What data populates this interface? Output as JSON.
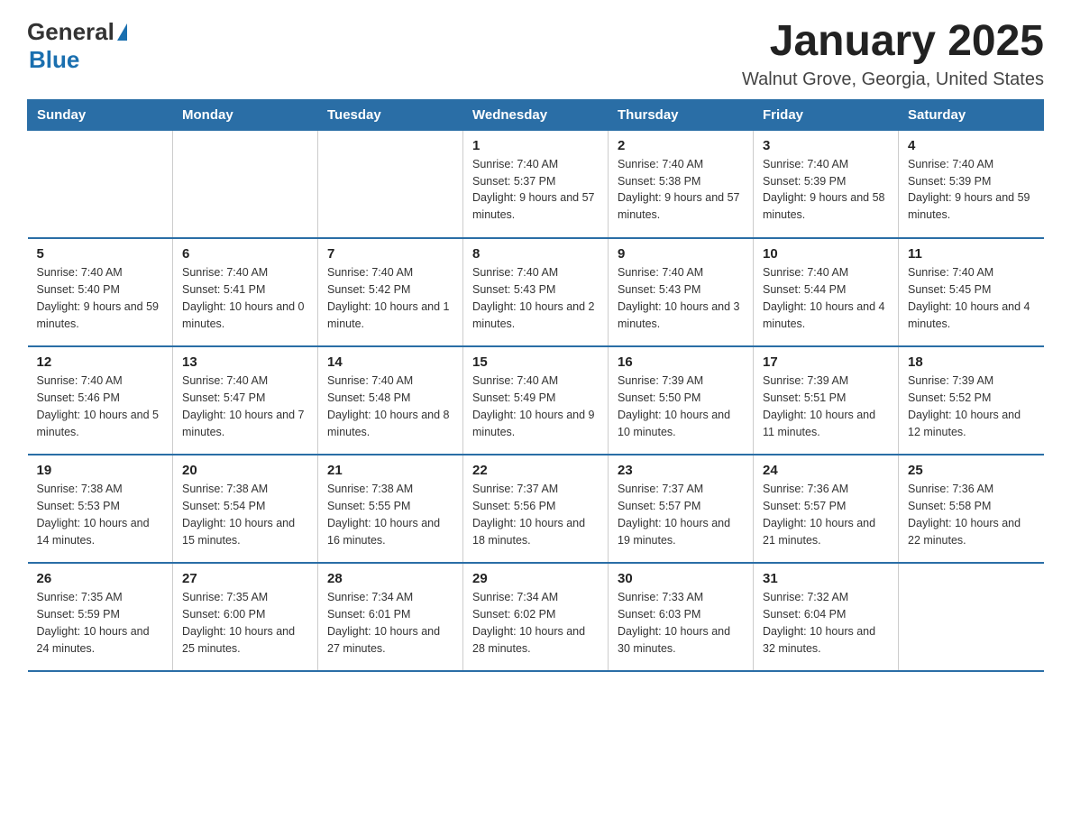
{
  "header": {
    "logo_general": "General",
    "logo_blue": "Blue",
    "month_title": "January 2025",
    "location": "Walnut Grove, Georgia, United States"
  },
  "calendar": {
    "days_of_week": [
      "Sunday",
      "Monday",
      "Tuesday",
      "Wednesday",
      "Thursday",
      "Friday",
      "Saturday"
    ],
    "weeks": [
      [
        {
          "day": "",
          "info": ""
        },
        {
          "day": "",
          "info": ""
        },
        {
          "day": "",
          "info": ""
        },
        {
          "day": "1",
          "info": "Sunrise: 7:40 AM\nSunset: 5:37 PM\nDaylight: 9 hours and 57 minutes."
        },
        {
          "day": "2",
          "info": "Sunrise: 7:40 AM\nSunset: 5:38 PM\nDaylight: 9 hours and 57 minutes."
        },
        {
          "day": "3",
          "info": "Sunrise: 7:40 AM\nSunset: 5:39 PM\nDaylight: 9 hours and 58 minutes."
        },
        {
          "day": "4",
          "info": "Sunrise: 7:40 AM\nSunset: 5:39 PM\nDaylight: 9 hours and 59 minutes."
        }
      ],
      [
        {
          "day": "5",
          "info": "Sunrise: 7:40 AM\nSunset: 5:40 PM\nDaylight: 9 hours and 59 minutes."
        },
        {
          "day": "6",
          "info": "Sunrise: 7:40 AM\nSunset: 5:41 PM\nDaylight: 10 hours and 0 minutes."
        },
        {
          "day": "7",
          "info": "Sunrise: 7:40 AM\nSunset: 5:42 PM\nDaylight: 10 hours and 1 minute."
        },
        {
          "day": "8",
          "info": "Sunrise: 7:40 AM\nSunset: 5:43 PM\nDaylight: 10 hours and 2 minutes."
        },
        {
          "day": "9",
          "info": "Sunrise: 7:40 AM\nSunset: 5:43 PM\nDaylight: 10 hours and 3 minutes."
        },
        {
          "day": "10",
          "info": "Sunrise: 7:40 AM\nSunset: 5:44 PM\nDaylight: 10 hours and 4 minutes."
        },
        {
          "day": "11",
          "info": "Sunrise: 7:40 AM\nSunset: 5:45 PM\nDaylight: 10 hours and 4 minutes."
        }
      ],
      [
        {
          "day": "12",
          "info": "Sunrise: 7:40 AM\nSunset: 5:46 PM\nDaylight: 10 hours and 5 minutes."
        },
        {
          "day": "13",
          "info": "Sunrise: 7:40 AM\nSunset: 5:47 PM\nDaylight: 10 hours and 7 minutes."
        },
        {
          "day": "14",
          "info": "Sunrise: 7:40 AM\nSunset: 5:48 PM\nDaylight: 10 hours and 8 minutes."
        },
        {
          "day": "15",
          "info": "Sunrise: 7:40 AM\nSunset: 5:49 PM\nDaylight: 10 hours and 9 minutes."
        },
        {
          "day": "16",
          "info": "Sunrise: 7:39 AM\nSunset: 5:50 PM\nDaylight: 10 hours and 10 minutes."
        },
        {
          "day": "17",
          "info": "Sunrise: 7:39 AM\nSunset: 5:51 PM\nDaylight: 10 hours and 11 minutes."
        },
        {
          "day": "18",
          "info": "Sunrise: 7:39 AM\nSunset: 5:52 PM\nDaylight: 10 hours and 12 minutes."
        }
      ],
      [
        {
          "day": "19",
          "info": "Sunrise: 7:38 AM\nSunset: 5:53 PM\nDaylight: 10 hours and 14 minutes."
        },
        {
          "day": "20",
          "info": "Sunrise: 7:38 AM\nSunset: 5:54 PM\nDaylight: 10 hours and 15 minutes."
        },
        {
          "day": "21",
          "info": "Sunrise: 7:38 AM\nSunset: 5:55 PM\nDaylight: 10 hours and 16 minutes."
        },
        {
          "day": "22",
          "info": "Sunrise: 7:37 AM\nSunset: 5:56 PM\nDaylight: 10 hours and 18 minutes."
        },
        {
          "day": "23",
          "info": "Sunrise: 7:37 AM\nSunset: 5:57 PM\nDaylight: 10 hours and 19 minutes."
        },
        {
          "day": "24",
          "info": "Sunrise: 7:36 AM\nSunset: 5:57 PM\nDaylight: 10 hours and 21 minutes."
        },
        {
          "day": "25",
          "info": "Sunrise: 7:36 AM\nSunset: 5:58 PM\nDaylight: 10 hours and 22 minutes."
        }
      ],
      [
        {
          "day": "26",
          "info": "Sunrise: 7:35 AM\nSunset: 5:59 PM\nDaylight: 10 hours and 24 minutes."
        },
        {
          "day": "27",
          "info": "Sunrise: 7:35 AM\nSunset: 6:00 PM\nDaylight: 10 hours and 25 minutes."
        },
        {
          "day": "28",
          "info": "Sunrise: 7:34 AM\nSunset: 6:01 PM\nDaylight: 10 hours and 27 minutes."
        },
        {
          "day": "29",
          "info": "Sunrise: 7:34 AM\nSunset: 6:02 PM\nDaylight: 10 hours and 28 minutes."
        },
        {
          "day": "30",
          "info": "Sunrise: 7:33 AM\nSunset: 6:03 PM\nDaylight: 10 hours and 30 minutes."
        },
        {
          "day": "31",
          "info": "Sunrise: 7:32 AM\nSunset: 6:04 PM\nDaylight: 10 hours and 32 minutes."
        },
        {
          "day": "",
          "info": ""
        }
      ]
    ]
  }
}
